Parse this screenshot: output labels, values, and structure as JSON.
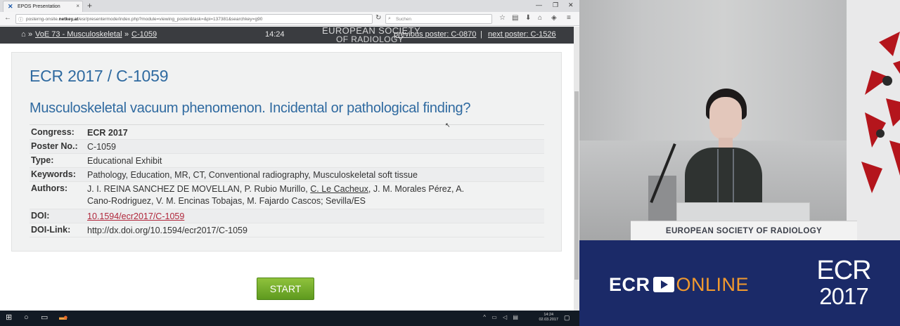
{
  "browser": {
    "tab_title": "EPOS Presentation",
    "url_host": "posterng-onsite.netkey.at",
    "url_prefix": "posterng-onsite.",
    "url_bold": "netkey.at",
    "url_rest": "/esr/presentermode/index.php?module=viewing_poster&task=&pi=137381&searchkey=g90",
    "search_placeholder": "Suchen"
  },
  "site_header": {
    "voe_link": "VoE 73 - Musculoskeletal",
    "poster_link": "C-1059",
    "time": "14:24",
    "watermark_line1": "EUROPEAN SOCIETY",
    "watermark_line2": "OF RADIOLOGY",
    "prev_link": "previous poster: C-0870",
    "separator": "|",
    "next_link": "next poster: C-1526"
  },
  "poster": {
    "code": "ECR 2017 / C-1059",
    "title": "Musculoskeletal vacuum phenomenon. Incidental or pathological finding?",
    "meta": {
      "congress_label": "Congress:",
      "congress": "ECR 2017",
      "poster_no_label": "Poster No.:",
      "poster_no": "C-1059",
      "type_label": "Type:",
      "type": "Educational Exhibit",
      "keywords_label": "Keywords:",
      "keywords": "Pathology, Education, MR, CT, Conventional radiography, Musculoskeletal soft tissue",
      "authors_label": "Authors:",
      "authors_part1": "J. I. REINA SANCHEZ DE MOVELLAN, P. Rubio Murillo, ",
      "authors_link": "C. Le Cacheux",
      "authors_part2": ", J. M. Morales Pérez, A.",
      "authors_line2": "Cano-Rodriguez, V. M. Encinas Tobajas, M. Fajardo Cascos; Sevilla/ES",
      "doi_label": "DOI:",
      "doi": "10.1594/ecr2017/C-1059",
      "doi_link_label": "DOI-Link:",
      "doi_link": "http://dx.doi.org/10.1594/ecr2017/C-1059"
    },
    "start_label": "START"
  },
  "taskbar": {
    "time": "14:24",
    "date": "02.03.2017"
  },
  "video": {
    "lectern_label": "EUROPEAN SOCIETY OF RADIOLOGY"
  },
  "banner": {
    "ecr_prefix": "ECR",
    "online_word": "ONLINE",
    "ecr_logo": "ECR",
    "year": "2017"
  },
  "colors": {
    "title_blue": "#2f6aa0",
    "doi_red": "#b0273b",
    "start_green": "#6fa829",
    "banner_navy": "#1b2a68",
    "online_orange": "#f29a2e"
  }
}
